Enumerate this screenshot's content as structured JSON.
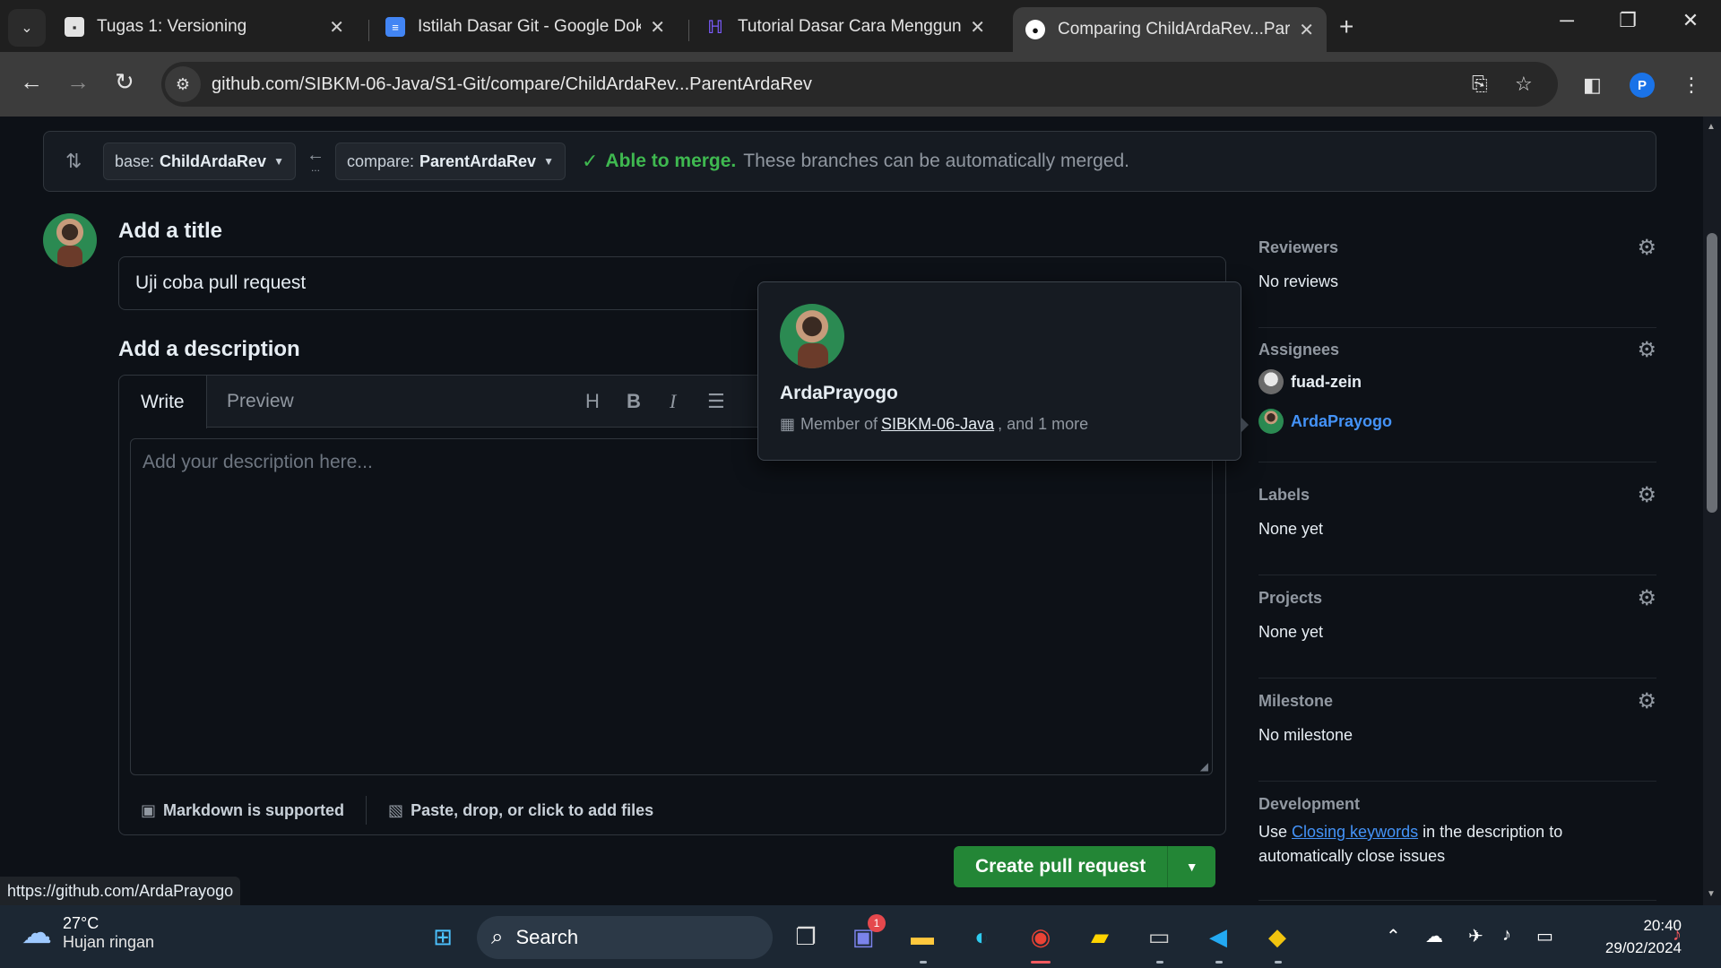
{
  "browser": {
    "tabs": [
      {
        "title": "Tugas 1: Versioning",
        "icon": "classroom-icon"
      },
      {
        "title": "Istilah Dasar Git - Google Dokum",
        "icon": "google-docs-icon"
      },
      {
        "title": "Tutorial Dasar Cara Menggunak",
        "icon": "site-icon"
      },
      {
        "title": "Comparing ChildArdaRev...Parer",
        "icon": "github-icon"
      }
    ],
    "url": "github.com/SIBKM-06-Java/S1-Git/compare/ChildArdaRev...ParentArdaRev",
    "profile_initial": "P"
  },
  "compare": {
    "base_prefix": "base:",
    "base_branch": "ChildArdaRev",
    "compare_prefix": "compare:",
    "compare_branch": "ParentArdaRev",
    "dots": "...",
    "merge_ok": "Able to merge.",
    "merge_msg": "These branches can be automatically merged."
  },
  "form": {
    "title_heading": "Add a title",
    "title_value": "Uji coba pull request",
    "desc_heading": "Add a description",
    "tab_write": "Write",
    "tab_preview": "Preview",
    "desc_placeholder": "Add your description here...",
    "markdown_note": "Markdown is supported",
    "attach_note": "Paste, drop, or click to add files",
    "create_button": "Create pull request"
  },
  "hovercard": {
    "name": "ArdaPrayogo",
    "member_prefix": "Member of",
    "org": "SIBKM-06-Java",
    "member_suffix": ", and 1 more"
  },
  "sidebar": {
    "reviewers_label": "Reviewers",
    "reviewers_value": "No reviews",
    "assignees_label": "Assignees",
    "assignee_1": "fuad-zein",
    "assignee_2": "ArdaPrayogo",
    "labels_label": "Labels",
    "labels_value": "None yet",
    "projects_label": "Projects",
    "projects_value": "None yet",
    "milestone_label": "Milestone",
    "milestone_value": "No milestone",
    "development_label": "Development",
    "dev_use": "Use",
    "dev_link": "Closing keywords",
    "dev_rest": "in the description to automatically close issues"
  },
  "status_url": "https://github.com/ArdaPrayogo",
  "taskbar": {
    "temperature": "27°C",
    "weather": "Hujan ringan",
    "search_label": "Search",
    "time": "20:40",
    "date": "29/02/2024",
    "teams_badge": "1"
  },
  "colors": {
    "accent_green": "#238636",
    "merge_green": "#3fb950",
    "link_blue": "#4493f8"
  }
}
